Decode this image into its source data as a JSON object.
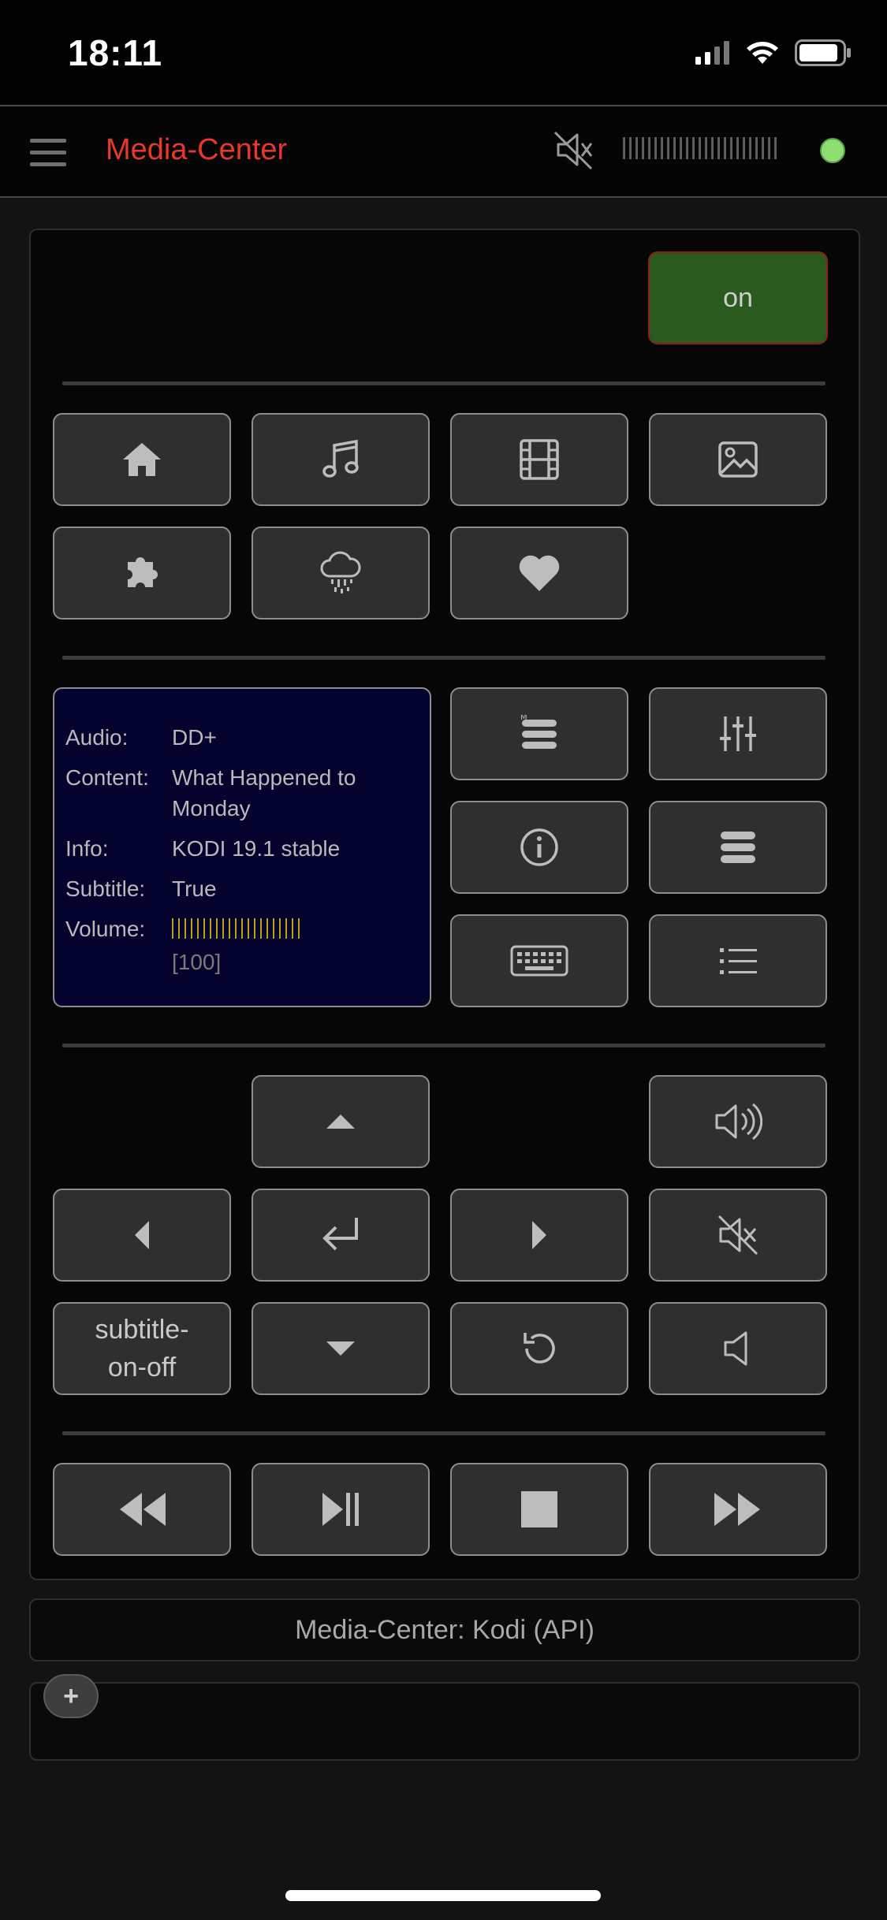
{
  "status_bar": {
    "time": "18:11"
  },
  "header": {
    "title": "Media-Center",
    "status_color": "#8fde71"
  },
  "power": {
    "label": "on"
  },
  "nav_buttons": [
    "home-icon",
    "music-icon",
    "film-icon",
    "image-icon",
    "puzzle-icon",
    "weather-icon",
    "heart-icon"
  ],
  "info": {
    "audio_label": "Audio:",
    "audio_value": "DD+",
    "content_label": "Content:",
    "content_value": "What Happened to Monday",
    "info_label": "Info:",
    "info_value": "KODI 19.1 stable",
    "subtitle_label": "Subtitle:",
    "subtitle_value": "True",
    "volume_label": "Volume:",
    "volume_value": "[100]",
    "volume_level": 100
  },
  "controls": {
    "subtitle_btn": "subtitle-on-off"
  },
  "footer": {
    "label": "Media-Center: Kodi (API)",
    "add_label": "+"
  },
  "colors": {
    "accent": "#e8382b",
    "power_bg": "#2a5a1d",
    "info_bg": "#03032e",
    "volume_bar": "#b8a21c"
  }
}
